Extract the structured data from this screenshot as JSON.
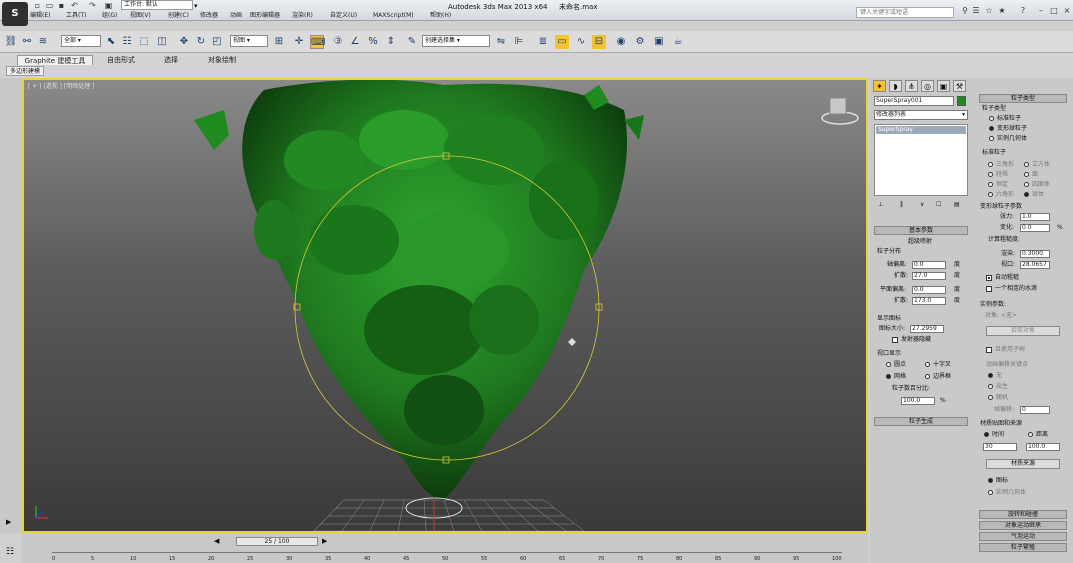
{
  "title": {
    "app_name": "Autodesk 3ds Max  2013 x64",
    "file_name": "未命名.max",
    "workspace": "工作台: 默认",
    "search_placeholder": "键入关键字或短语"
  },
  "menubar": [
    "编辑(E)",
    "工具(T)",
    "组(G)",
    "视图(V)",
    "创建(C)",
    "修改器",
    "动画",
    "图形编辑器",
    "渲染(R)",
    "自定义(U)",
    "MAXScript(M)",
    "帮助(H)"
  ],
  "toolbar": {
    "selection_filter": "全部",
    "coord_system": "视图",
    "named_selection": "创建选择集"
  },
  "ribbon": {
    "tabs": [
      "Graphite 建模工具",
      "自由形式",
      "选择",
      "对象绘制"
    ],
    "subtab": "多边形建模"
  },
  "viewport": {
    "label": "[ + ] [透视 ] [明暗处理 ]",
    "colors": {
      "border": "#e8d334",
      "foliage": "#1f7a1f",
      "gizmo": "#d9c93a"
    }
  },
  "command_panel": {
    "object_name": "SuperSpray001",
    "modifier_list": "修改器列表",
    "stack_item": "SuperSpray",
    "basic_params": {
      "header": "基本参数",
      "subtitle": "超级喷射",
      "particle_formation_label": "粒子分布",
      "axis_offset_label": "轴偏离:",
      "axis_offset": "0.0",
      "axis_unit": "度",
      "spread1_label": "扩散:",
      "spread1": "27.0",
      "plane_offset_label": "平面偏离:",
      "plane_offset": "0.0",
      "spread2_label": "扩散:",
      "spread2": "173.0",
      "display_icon_label": "显示图标",
      "icon_size_label": "图标大小:",
      "icon_size": "27.2959",
      "emitter_hidden_label": "发射器隐藏",
      "viewport_display_label": "视口显示",
      "display_options": [
        "圆点",
        "十字叉",
        "网格",
        "边界框"
      ],
      "display_selected": "网格",
      "percent_label": "粒子数百分比:",
      "percent": "100.0",
      "percent_unit": "%"
    },
    "particle_gen": "粒子生成",
    "particle_type": {
      "header": "粒子类型",
      "type_label": "粒子类型",
      "types": [
        "标准粒子",
        "变形球粒子",
        "实例几何体"
      ],
      "type_selected": "变形球粒子",
      "standard_label": "标准粒子",
      "standard_options": [
        "三角形",
        "立方体",
        "特殊",
        "面",
        "恒定",
        "四面体",
        "六角形",
        "球体"
      ],
      "metaball_label": "变形球粒子参数",
      "tension_label": "张力:",
      "tension": "1.0",
      "variation_label": "变化:",
      "variation": "0.0",
      "calc_coarseness": "计算粗糙度:",
      "render_label": "渲染:",
      "render_val": "0.3000",
      "viewport_label": "视口:",
      "viewport_val": "28.0657",
      "auto_coarse": "自动粗糙",
      "one_connected": "一个相连的水滴",
      "instance_label": "实例参数:",
      "object_label": "对象: <无>",
      "pick_object": "拾取对象",
      "use_subtree": "且使用子树",
      "anim_offset_label": "动画偏移关键点",
      "anim_options": [
        "无",
        "出生",
        "随机"
      ],
      "frame_offset_label": "帧偏移:",
      "frame_offset": "0",
      "material_mapping": "材质贴图和来源",
      "time_label": "时间",
      "distance_label": "距离",
      "time_val": "30",
      "distance_val": "100.0",
      "material_source": "材质来源",
      "icon_label": "图标",
      "instanced_geo": "实例几何体"
    },
    "bottom_rollouts": [
      "旋转和碰撞",
      "对象运动继承",
      "气泡运动",
      "粒子繁殖"
    ]
  },
  "timeline": {
    "frame": "25 / 100",
    "ticks": [
      "0",
      "5",
      "10",
      "15",
      "20",
      "25",
      "30",
      "35",
      "40",
      "45",
      "50",
      "55",
      "60",
      "65",
      "70",
      "75",
      "80",
      "85",
      "90",
      "95",
      "100"
    ]
  }
}
